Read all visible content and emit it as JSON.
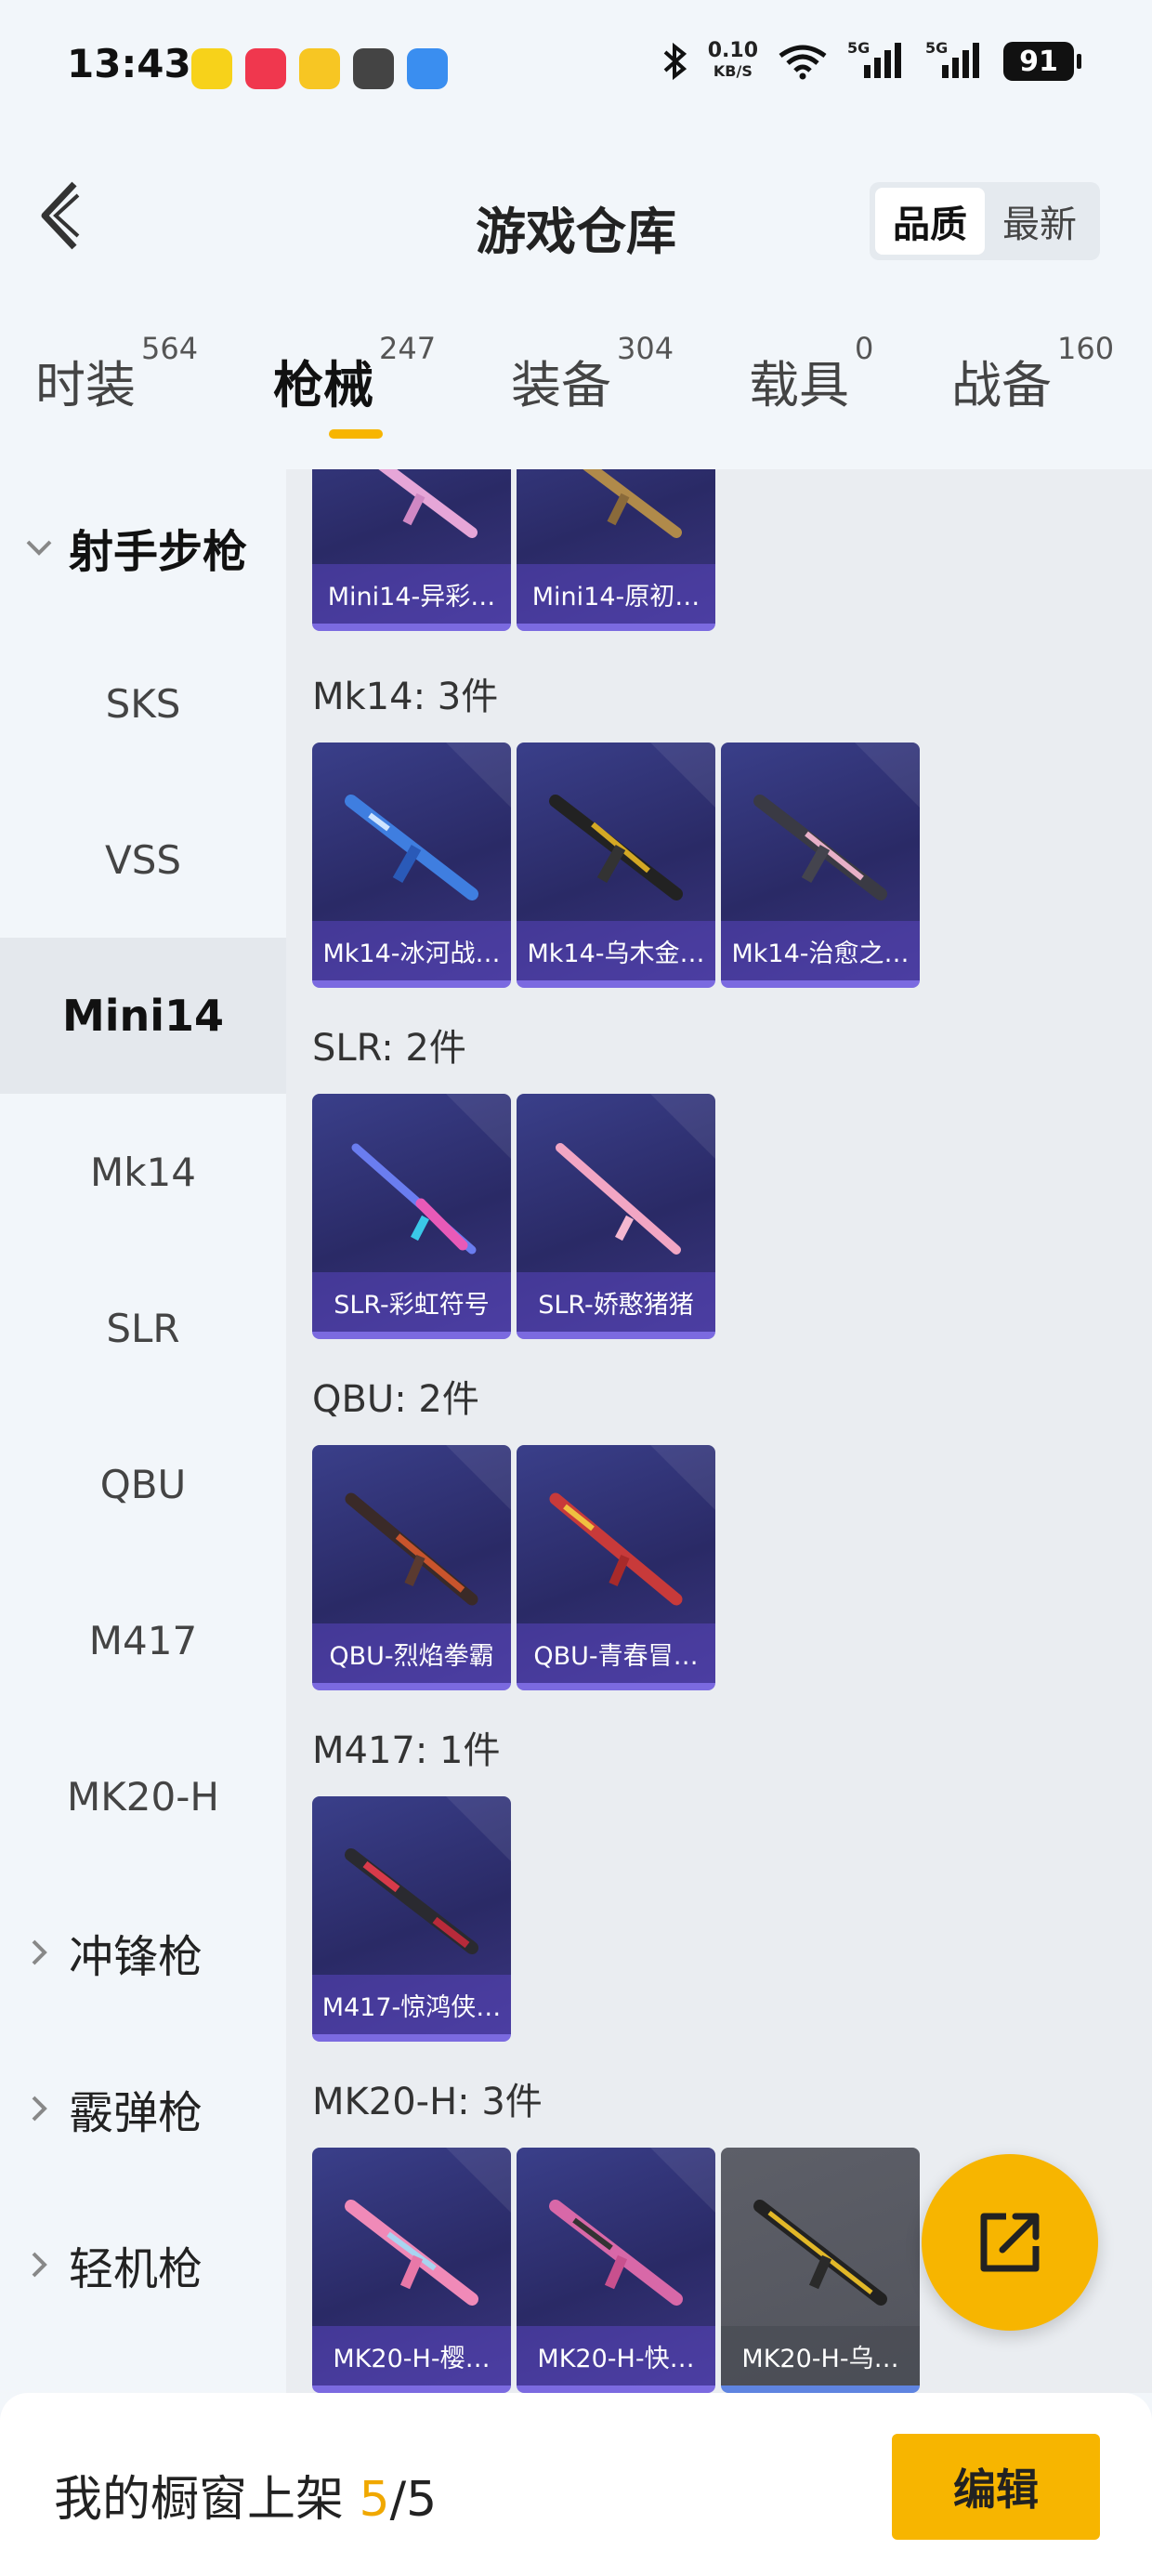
{
  "status_bar": {
    "time": "13:43",
    "net_speed_value": "0.10",
    "net_speed_unit": "KB/S",
    "signal_1": "5G",
    "signal_2": "5G",
    "battery": "91"
  },
  "header": {
    "title": "游戏仓库",
    "sort_options": [
      "品质",
      "最新"
    ],
    "sort_selected": "品质"
  },
  "tabs": [
    {
      "label": "时装",
      "count": "564"
    },
    {
      "label": "枪械",
      "count": "247",
      "active": true
    },
    {
      "label": "装备",
      "count": "304"
    },
    {
      "label": "载具",
      "count": "0"
    },
    {
      "label": "战备",
      "count": "160"
    }
  ],
  "sidebar": {
    "group_open": "射手步枪",
    "items": [
      "SKS",
      "VSS",
      "Mini14",
      "Mk14",
      "SLR",
      "QBU",
      "M417",
      "MK20-H"
    ],
    "active_item": "Mini14",
    "collapsed_groups": [
      "冲锋枪",
      "霰弹枪",
      "轻机枪"
    ]
  },
  "content": {
    "top_cards": [
      "Mini14-异彩…",
      "Mini14-原初…"
    ],
    "groups": [
      {
        "label": "Mk14: 3件",
        "items": [
          "Mk14-冰河战…",
          "Mk14-乌木金…",
          "Mk14-治愈之…"
        ]
      },
      {
        "label": "SLR: 2件",
        "items": [
          "SLR-彩虹符号",
          "SLR-娇憨猪猪"
        ]
      },
      {
        "label": "QBU: 2件",
        "items": [
          "QBU-烈焰拳霸",
          "QBU-青春冒…"
        ]
      },
      {
        "label": "M417: 1件",
        "items": [
          "M417-惊鸿侠…"
        ]
      },
      {
        "label": "MK20-H: 3件",
        "items": [
          "MK20-H-樱…",
          "MK20-H-快…",
          "MK20-H-乌…"
        ]
      }
    ]
  },
  "bottom_bar": {
    "text_prefix": "我的橱窗上架 ",
    "count_current": "5",
    "count_sep": "/",
    "count_total": "5",
    "edit_label": "编辑"
  },
  "colors": {
    "accent": "#f7b500",
    "card_purple": "#2f2f6e",
    "card_gray": "#56585f"
  }
}
